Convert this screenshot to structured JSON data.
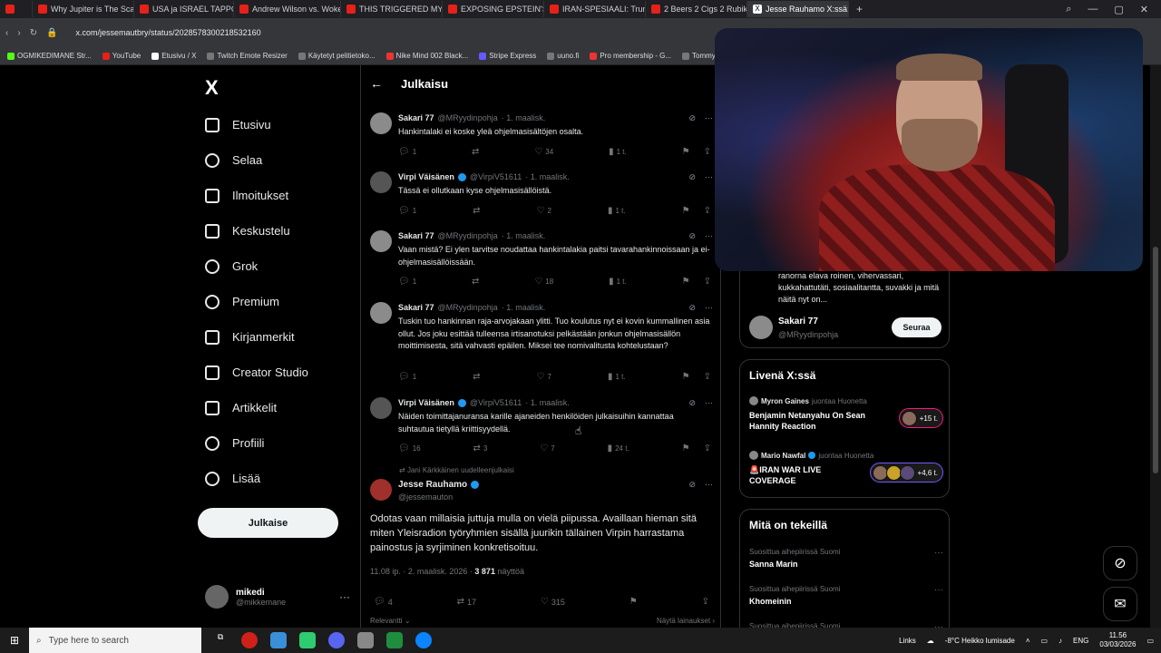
{
  "browser": {
    "tabs": [
      {
        "label": "Why Jupiter is The Scariest",
        "active": false
      },
      {
        "label": "USA ja ISRAEL TAPPO",
        "active": false
      },
      {
        "label": "Andrew Wilson vs. Woke",
        "active": false
      },
      {
        "label": "THIS TRIGGERED MY BIGG",
        "active": false
      },
      {
        "label": "EXPOSING EPSTEIN'S ZO",
        "active": false
      },
      {
        "label": "IRAN-SPESIAALI: Trumpin",
        "active": false
      },
      {
        "label": "2 Beers 2 Cigs 2 Rubiks Cu",
        "active": false
      },
      {
        "label": "Jesse Rauhamo X:ssä: \"@",
        "active": true
      }
    ],
    "new_tab": "+",
    "url": "x.com/jessemautbry/status/2028578300218532160",
    "bookmarks": [
      "OGMIKEDIMANE Str...",
      "YouTube",
      "Etusivu / X",
      "Twitch Emote Resizer",
      "Käytetyt pelitietoko...",
      "Nike Mind 002 Black...",
      "Stripe Express",
      "uuno.fi",
      "Pro membership - G...",
      "Tommy Jea"
    ]
  },
  "nav": {
    "logo": "X",
    "items": [
      {
        "label": "Etusivu",
        "icon": "home-icon"
      },
      {
        "label": "Selaa",
        "icon": "search-icon"
      },
      {
        "label": "Ilmoitukset",
        "icon": "bell-icon"
      },
      {
        "label": "Keskustelu",
        "icon": "mail-icon"
      },
      {
        "label": "Grok",
        "icon": "grok-icon"
      },
      {
        "label": "Premium",
        "icon": "premium-icon"
      },
      {
        "label": "Kirjanmerkit",
        "icon": "bookmark-icon"
      },
      {
        "label": "Creator Studio",
        "icon": "creator-icon"
      },
      {
        "label": "Artikkelit",
        "icon": "articles-icon"
      },
      {
        "label": "Profiili",
        "icon": "profile-icon"
      },
      {
        "label": "Lisää",
        "icon": "more-icon"
      }
    ],
    "post_button": "Julkaise",
    "profile": {
      "name": "mikedi",
      "handle": "@mikkemane",
      "more": "···"
    }
  },
  "center": {
    "back": "←",
    "title": "Julkaisu",
    "replies": [
      {
        "name": "Sakari 77",
        "handle": "@MRyydinpohja",
        "date": "· 1. maalisk.",
        "verified": false,
        "text": "Hankintalaki ei koske yleä ohjelmasisältöjen osalta.",
        "replies": "1",
        "reposts": "",
        "likes": "34",
        "views": "1 t."
      },
      {
        "name": "Virpi Väisänen",
        "handle": "@VirpiV51611",
        "date": "· 1. maalisk.",
        "verified": true,
        "text": "Tässä ei ollutkaan kyse ohjelmasisällöistä.",
        "replies": "1",
        "reposts": "",
        "likes": "2",
        "views": "1 t."
      },
      {
        "name": "Sakari 77",
        "handle": "@MRyydinpohja",
        "date": "· 1. maalisk.",
        "verified": false,
        "text": "Vaan mistä? Ei ylen tarvitse noudattaa hankintalakia paitsi tavarahankinnoissaan ja ei-ohjelmasisällöissään.",
        "replies": "1",
        "reposts": "",
        "likes": "18",
        "views": "1 t."
      },
      {
        "name": "Sakari 77",
        "handle": "@MRyydinpohja",
        "date": "· 1. maalisk.",
        "verified": false,
        "text": "Tuskin tuo hankinnan raja-arvojakaan ylitti. Tuo koulutus nyt ei kovin kummallinen asia ollut. Jos joku esittää tulleensa irtisanotuksi pelkästään jonkun ohjelmasisällön moittimisesta, sitä vahvasti epäilen. Miksei tee nomivalitusta kohtelustaan?",
        "replies": "1",
        "reposts": "",
        "likes": "7",
        "views": "1 t."
      },
      {
        "name": "Virpi Väisänen",
        "handle": "@VirpiV51611",
        "date": "· 1. maalisk.",
        "verified": true,
        "text": "Näiden toimittajanuransa karille ajaneiden henkilöiden julkaisuihin  kannattaa suhtautua tietyllä kriittisyydellä.",
        "replies": "16",
        "reposts": "3",
        "likes": "7",
        "views": "24 t."
      }
    ],
    "main": {
      "retweeted_by": "Jani Kärkkäinen uudelleenjulkaisi",
      "name": "Jesse Rauhamo",
      "handle": "@jessemauton",
      "text": "Odotas vaan millaisia juttuja mulla on vielä piipussa. Availlaan hieman sitä miten Yleisradion työryhmien sisällä juurikin tällainen Virpin harrastama painostus ja syrjiminen konkretisoituu.",
      "time": "11.08 ip. · 2. maalisk. 2026 ·",
      "views_count": "3 871",
      "views_label": "näyttöä",
      "replies": "4",
      "reposts": "17",
      "likes": "315"
    },
    "sort_label": "Relevantti",
    "show_reposts": "Näytä lainaukset"
  },
  "right": {
    "bio_snippet": "ranorna elava roinen, vihervassari, kukkahattutäti, sosiaalitantta, suvakki ja mitä näitä nyt on...",
    "suggest": {
      "name": "Sakari 77",
      "handle": "@MRyydinpohja",
      "follow": "Seuraa"
    },
    "live_title": "Livenä X:ssä",
    "live": [
      {
        "host": "Myron Gaines",
        "hosting": "juontaa Huonetta",
        "title": "Benjamin Netanyahu On Sean Hannity Reaction",
        "count": "+15 t."
      },
      {
        "host": "Mario Nawfal",
        "hosting": "juontaa Huonetta",
        "title": "🚨IRAN WAR LIVE COVERAGE",
        "count": "+4,6 t."
      }
    ],
    "trends_title": "Mitä on tekeillä",
    "trends": [
      {
        "context": "Suosittua aihepiirissä Suomi",
        "title": "Sanna Marin"
      },
      {
        "context": "Suosittua aihepiirissä Suomi",
        "title": "Khomeinin"
      },
      {
        "context": "Suosittua aihepiirissä Suomi",
        "title": ""
      }
    ]
  },
  "taskbar": {
    "search_placeholder": "Type here to search",
    "links": "Links",
    "weather": "-8°C  Heikko lumisade",
    "lang": "ENG",
    "time": "11.56",
    "date": "03/03/2026"
  }
}
